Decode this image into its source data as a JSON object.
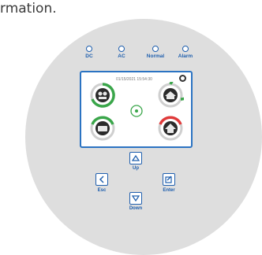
{
  "caption": "rmation.",
  "indicators": [
    {
      "label": "DC"
    },
    {
      "label": "AC"
    },
    {
      "label": "Normal"
    },
    {
      "label": "Alarm"
    }
  ],
  "screen": {
    "status_text": "01/15/2021  15:54:30  ",
    "icons": [
      "alarm-icon",
      "battery-module-icon",
      "grid-module-icon",
      "load-module-icon",
      "inverter-module-icon"
    ]
  },
  "buttons": {
    "up": "Up",
    "down": "Down",
    "esc": "Esc",
    "enter": "Enter"
  },
  "colors": {
    "accent": "#1f5fae",
    "screen_border": "#2b73c2",
    "gauge_green": "#3aa64a",
    "panel": "#dedede"
  }
}
